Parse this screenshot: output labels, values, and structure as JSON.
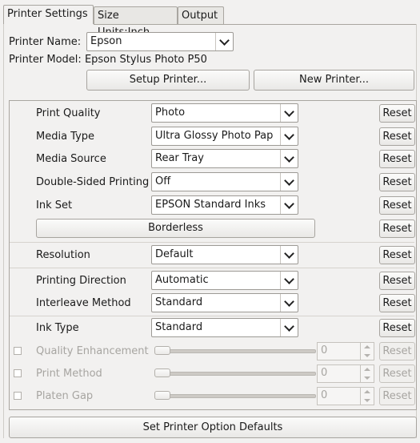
{
  "tabs": [
    {
      "label": "Printer Settings"
    },
    {
      "label": "Size Units:"
    },
    {
      "label": "Inch"
    },
    {
      "label": "Output"
    }
  ],
  "printer": {
    "name_label": "Printer Name:",
    "name_value": "Epson",
    "model_label": "Printer Model:",
    "model_value": "Epson Stylus Photo P50",
    "setup_button": "Setup Printer...",
    "new_button": "New Printer..."
  },
  "options": [
    {
      "label": "Print Quality",
      "value": "Photo"
    },
    {
      "label": "Media Type",
      "value": "Ultra Glossy Photo Pap"
    },
    {
      "label": "Media Source",
      "value": "Rear Tray"
    },
    {
      "label": "Double-Sided Printing",
      "value": "Off"
    },
    {
      "label": "Ink Set",
      "value": "EPSON Standard Inks"
    },
    {
      "label": "Borderless",
      "value": ""
    },
    {
      "label": "Resolution",
      "value": "Default"
    },
    {
      "label": "Printing Direction",
      "value": "Automatic"
    },
    {
      "label": "Interleave Method",
      "value": "Standard"
    },
    {
      "label": "Ink Type",
      "value": "Standard"
    }
  ],
  "disabled_options": [
    {
      "label": "Quality Enhancement",
      "value": "0"
    },
    {
      "label": "Print Method",
      "value": "0"
    },
    {
      "label": "Platen Gap",
      "value": "0"
    }
  ],
  "reset_label": "Reset",
  "defaults_button": "Set Printer Option Defaults"
}
